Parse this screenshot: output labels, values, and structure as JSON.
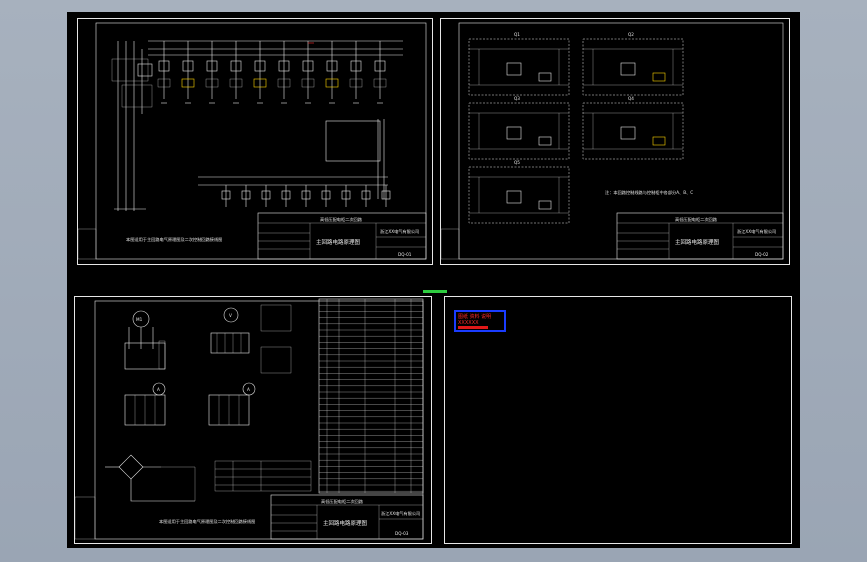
{
  "sheet1": {
    "title": "主回路电路原理图",
    "project": "高低压配电柜二次回路",
    "company": "浙江XX电气有限公司",
    "note": "本图适用于主回路电气原理图及二次控制回路接线图",
    "drawing_no": "DQ-01"
  },
  "sheet2": {
    "title": "主回路电路原理图",
    "project": "高低压配电柜二次回路",
    "company": "浙江XX电气有限公司",
    "panels": [
      "Q1",
      "Q2",
      "Q3",
      "Q4",
      "Q5"
    ],
    "note": "注：本回路控制线路与控制柜中各部分A、B、C",
    "drawing_no": "DQ-02"
  },
  "sheet3": {
    "title": "主回路电路原理图",
    "project": "高低压配电柜二次回路",
    "company": "浙江XX电气有限公司",
    "meter_labels": [
      "M1",
      "V",
      "A",
      "A"
    ],
    "note": "本图适用于主回路电气原理图及二次控制回路接线图",
    "drawing_no": "DQ-03"
  },
  "sheet4": {
    "stamp_lines": [
      "图纸 资料 说明",
      "XXXXXX"
    ]
  },
  "separator_label": "═══",
  "colors": {
    "background": "#9fa9b6",
    "canvas": "#000000",
    "line": "#e6e6e6",
    "stamp_fill": "#e01818",
    "stamp_border": "#1a3cff",
    "accent_green": "#2ecc40"
  }
}
